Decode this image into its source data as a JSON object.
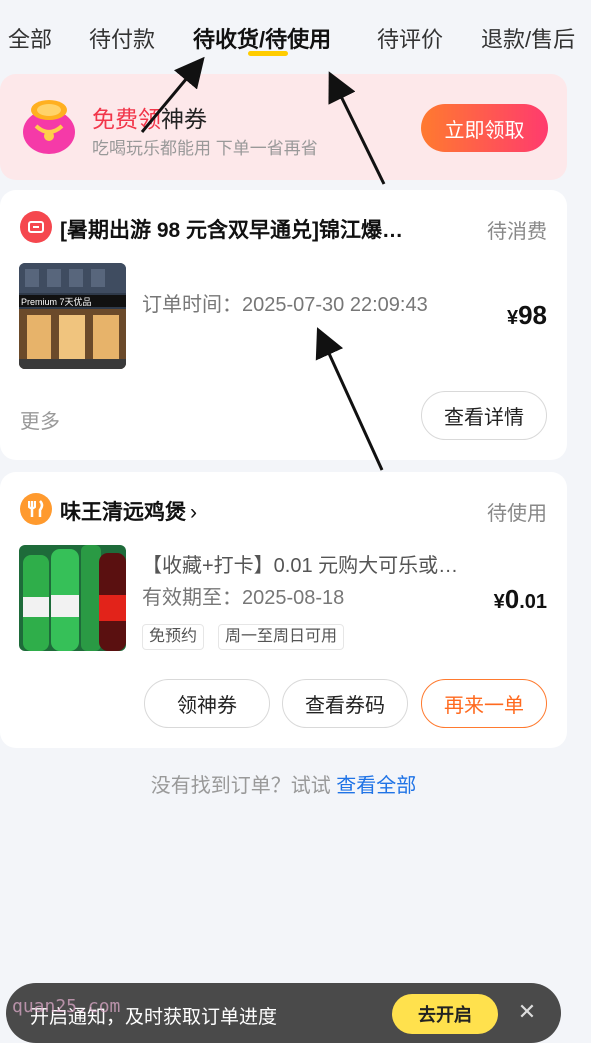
{
  "tabs": [
    "全部",
    "待付款",
    "待收货/待使用",
    "待评价",
    "退款/售后"
  ],
  "promo": {
    "title_red": "免费领",
    "title_rest": "神券",
    "subtitle": "吃喝玩乐都能用 下单一省再省",
    "button": "立即领取"
  },
  "orders": [
    {
      "title": "[暑期出游 98 元含双早通兑]锦江爆…",
      "status": "待消费",
      "thumb_text": "Premium 7天优品",
      "order_time": "订单时间：2025-07-30 22:09:43",
      "price_symbol": "¥",
      "price": "98",
      "more": "更多",
      "detail_button": "查看详情"
    },
    {
      "shop": "味王清远鸡煲",
      "status": "待使用",
      "deal": "【收藏+打卡】0.01 元购大可乐或…",
      "valid": "有效期至：2025-08-18",
      "price_symbol": "¥",
      "price_int": "0",
      "price_dec": ".01",
      "tags": [
        "免预约",
        "周一至周日可用"
      ],
      "buttons": [
        "领神券",
        "查看券码",
        "再来一单"
      ]
    }
  ],
  "no_order": {
    "text": "没有找到订单？试试 ",
    "link": "查看全部"
  },
  "notification": {
    "text": "开启通知，及时获取订单进度",
    "button": "去开启"
  },
  "watermark": "quan25.com",
  "colors": {
    "accent_yellow": "#ffcc00",
    "promo_red": "#f2364a",
    "link_blue": "#1f73e6",
    "reorder_orange": "#ff6a1f"
  }
}
